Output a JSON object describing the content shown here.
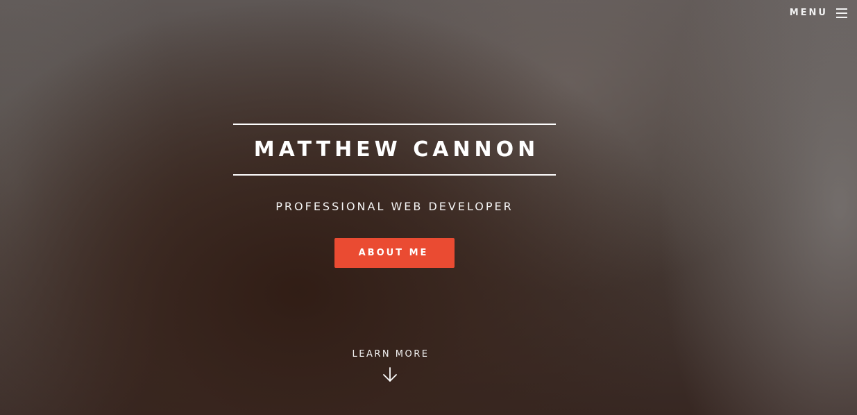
{
  "header": {
    "menu_label": "MENU",
    "menu_icon": "hamburger-icon"
  },
  "hero": {
    "title": "MATTHEW CANNON",
    "tagline": "PROFESSIONAL WEB DEVELOPER",
    "cta_label": "ABOUT ME",
    "cta_color": "#ea4b32"
  },
  "scroll_hint": {
    "label": "LEARN MORE",
    "icon": "arrow-down-icon"
  }
}
